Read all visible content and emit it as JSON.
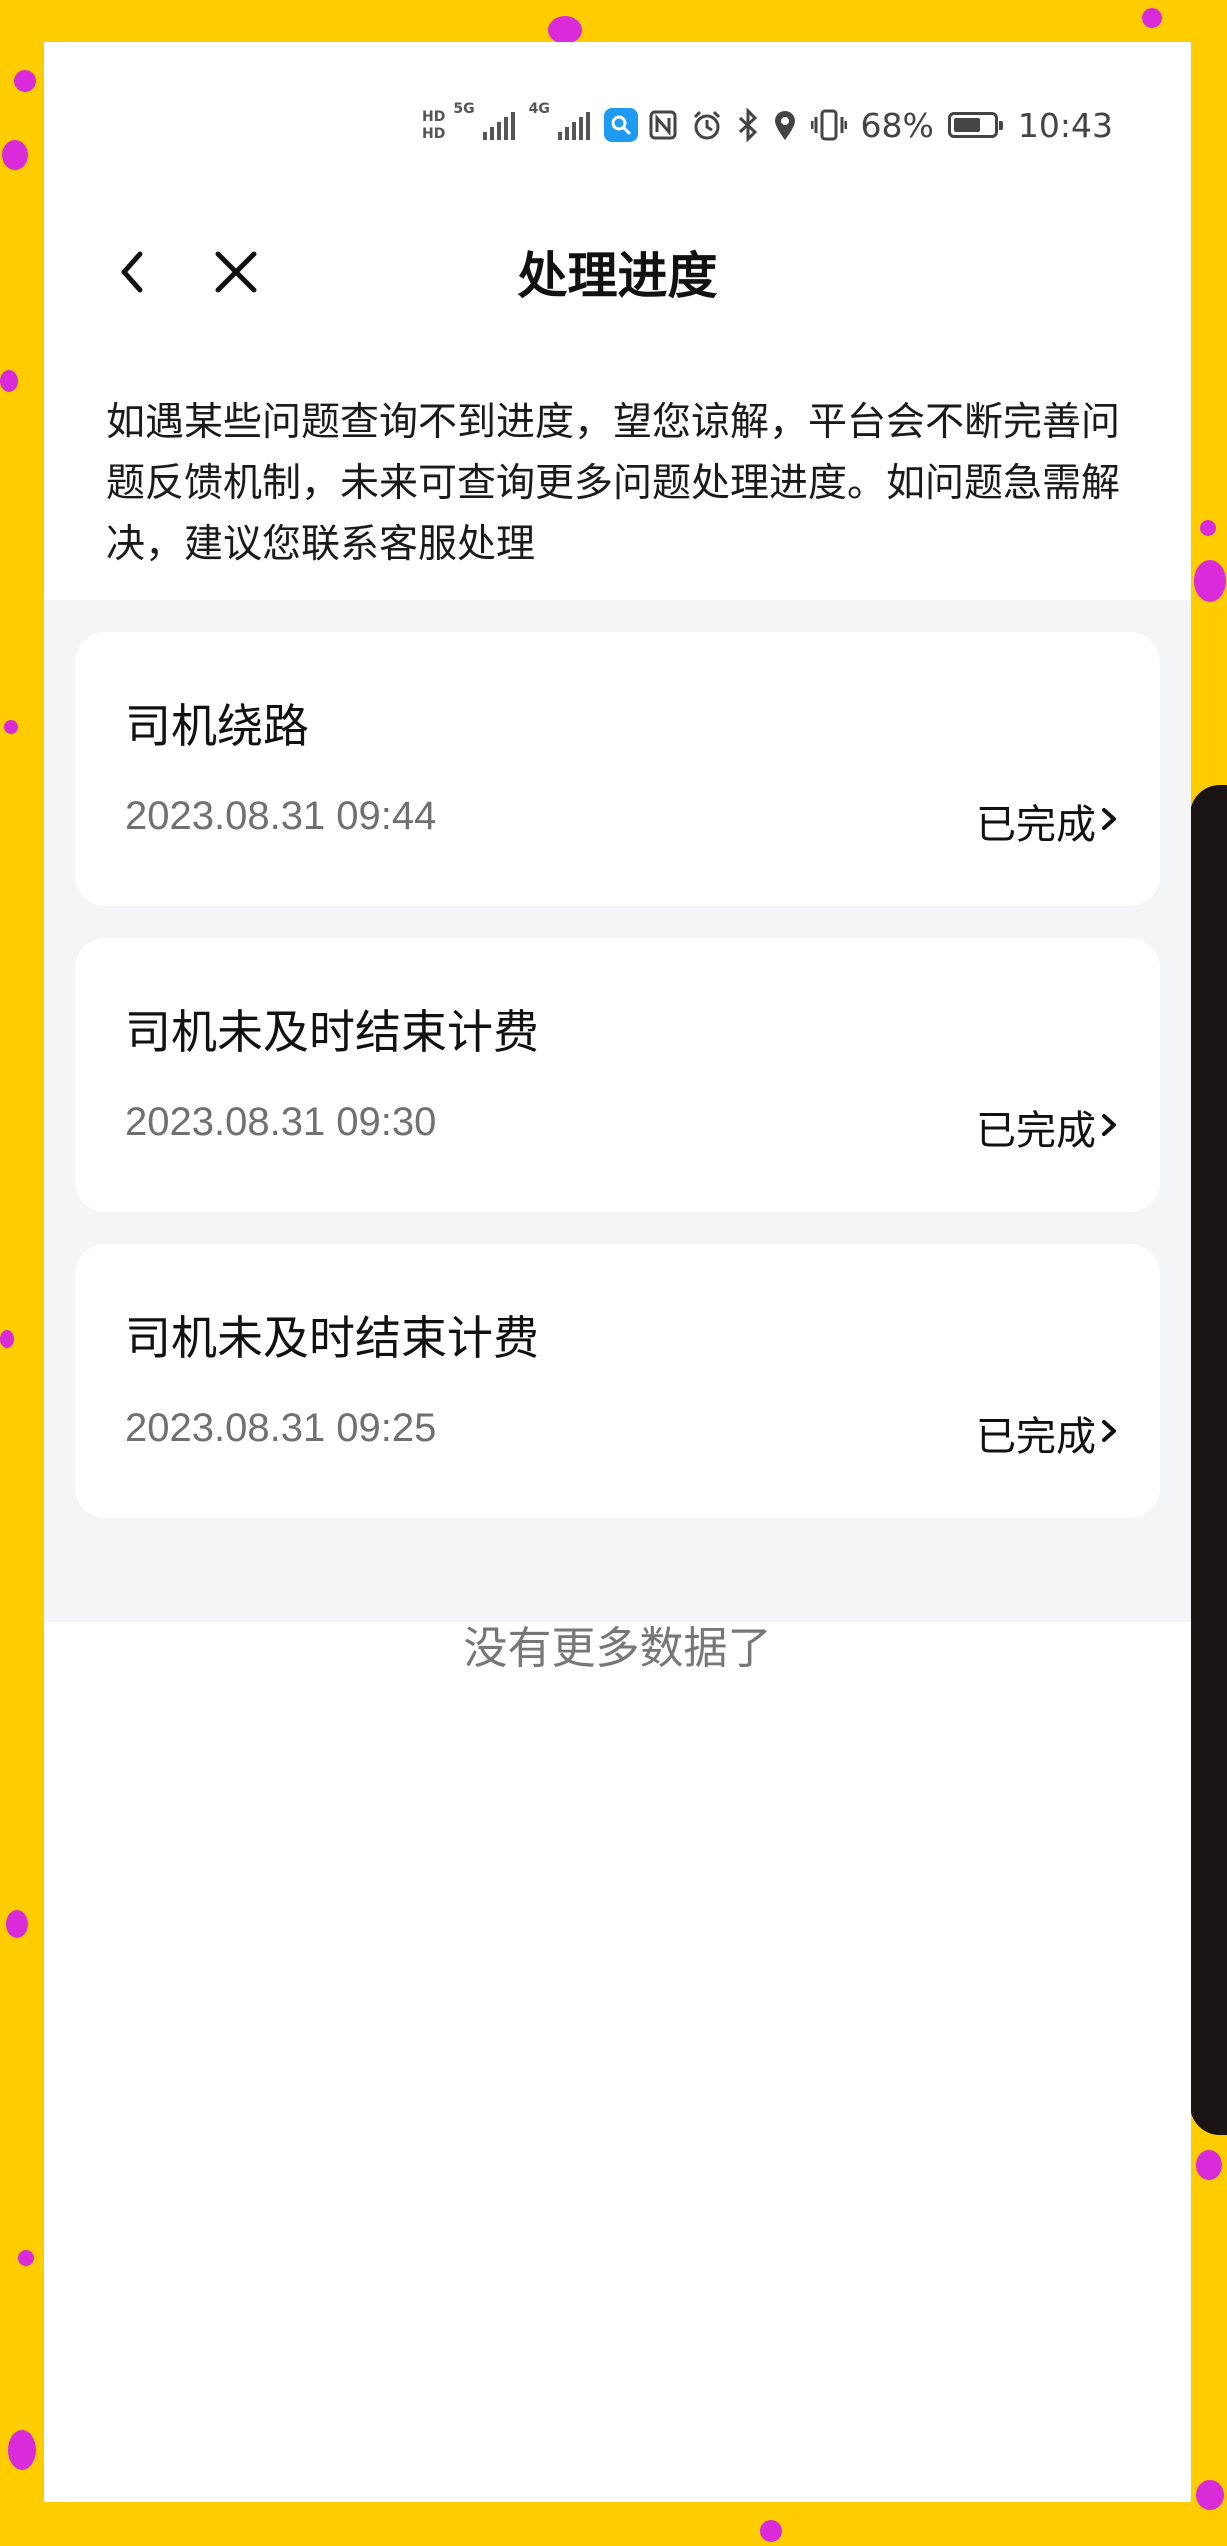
{
  "status_bar": {
    "hd_top": "HD",
    "hd_bottom": "HD",
    "net1": "5G",
    "net2": "4G",
    "battery_text": "68%",
    "battery_level": 0.68,
    "time": "10:43",
    "icons": [
      "nfc-icon",
      "alarm-icon",
      "bluetooth-icon",
      "location-icon",
      "vibrate-icon",
      "battery-icon"
    ]
  },
  "nav": {
    "title": "处理进度",
    "back_icon": "chevron-left-icon",
    "close_icon": "close-icon"
  },
  "notice": "如遇某些问题查询不到进度，望您谅解，平台会不断完善问题反馈机制，未来可查询更多问题处理进度。如问题急需解决，建议您联系客服处理",
  "records": [
    {
      "title": "司机绕路",
      "time": "2023.08.31 09:44",
      "status": "已完成"
    },
    {
      "title": "司机未及时结束计费",
      "time": "2023.08.31 09:30",
      "status": "已完成"
    },
    {
      "title": "司机未及时结束计费",
      "time": "2023.08.31 09:25",
      "status": "已完成"
    }
  ],
  "footer": {
    "no_more": "没有更多数据了"
  },
  "colors": {
    "frame_yellow": "#FFCC00",
    "dot_magenta": "#D92BD9",
    "list_bg": "#F4F5F7"
  }
}
